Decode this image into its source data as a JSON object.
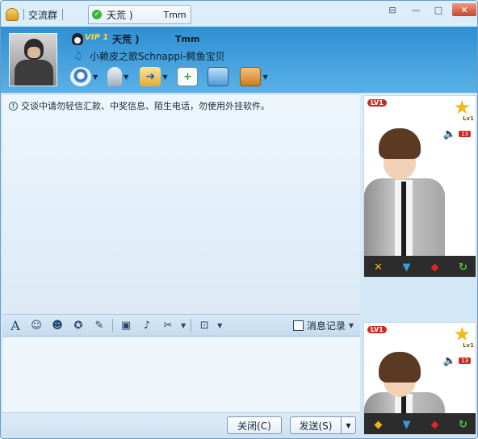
{
  "tabs": {
    "group_label": "交流群",
    "active_name": "天荒 )",
    "active_sub": "Tmm"
  },
  "window_controls": {
    "menu": "⊟",
    "minimize": "—",
    "maximize": "□",
    "close": "✕"
  },
  "contact": {
    "vip": "VIP 1",
    "nickname": "天荒 )",
    "account": "Tmm",
    "signature": "小赖皮之歌Schnappi-鳄鱼宝贝"
  },
  "chat": {
    "warning": "交谈中请勿轻信汇款、中奖信息、陌生电话，勿使用外挂软件。"
  },
  "format_toolbar": {
    "history_label": "消息记录"
  },
  "buttons": {
    "close_label": "关闭(C)",
    "send_label": "发送(S)",
    "send_dropdown": "▼"
  },
  "show_panel": {
    "level_badge": "LV1",
    "star_level": "Lv1",
    "sound_count": "13"
  },
  "colors": {
    "header": "#2f8fd3",
    "accent": "#6b9cc6"
  }
}
